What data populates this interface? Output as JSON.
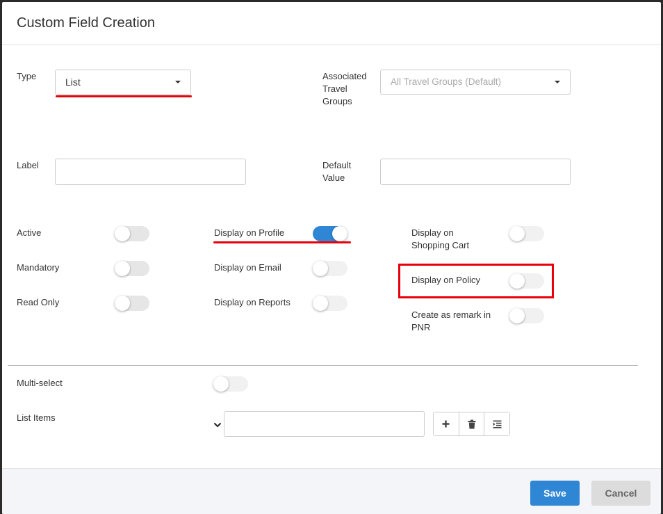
{
  "header": {
    "title": "Custom Field Creation"
  },
  "form": {
    "type": {
      "label": "Type",
      "value": "List"
    },
    "travel_groups": {
      "label_lines": [
        "Associated",
        "Travel",
        "Groups"
      ],
      "placeholder": "All Travel Groups (Default)"
    },
    "label_field": {
      "label": "Label",
      "value": ""
    },
    "default_value": {
      "label_lines": [
        "Default",
        "Value"
      ],
      "value": ""
    },
    "toggles": {
      "active": {
        "label": "Active",
        "on": false
      },
      "mandatory": {
        "label": "Mandatory",
        "on": false
      },
      "read_only": {
        "label": "Read Only",
        "on": false
      },
      "display_profile": {
        "label": "Display on Profile",
        "on": true
      },
      "display_email": {
        "label": "Display on Email",
        "on": false
      },
      "display_reports": {
        "label": "Display on Reports",
        "on": false
      },
      "display_cart": {
        "label_lines": [
          "Display on",
          "Shopping Cart"
        ],
        "on": false
      },
      "display_policy": {
        "label": "Display on Policy",
        "on": false
      },
      "remark_pnr": {
        "label_lines": [
          "Create as remark in",
          "PNR"
        ],
        "on": false
      }
    },
    "multi_select": {
      "label": "Multi-select",
      "on": false
    },
    "list_items": {
      "label": "List Items",
      "dropdown_icon": "chevron-down-icon",
      "input_value": "",
      "actions": [
        "plus-icon",
        "trash-icon",
        "indent-icon"
      ]
    }
  },
  "footer": {
    "save_label": "Save",
    "cancel_label": "Cancel"
  },
  "colors": {
    "primary": "#2e86d4",
    "highlight": "#e8000b"
  }
}
